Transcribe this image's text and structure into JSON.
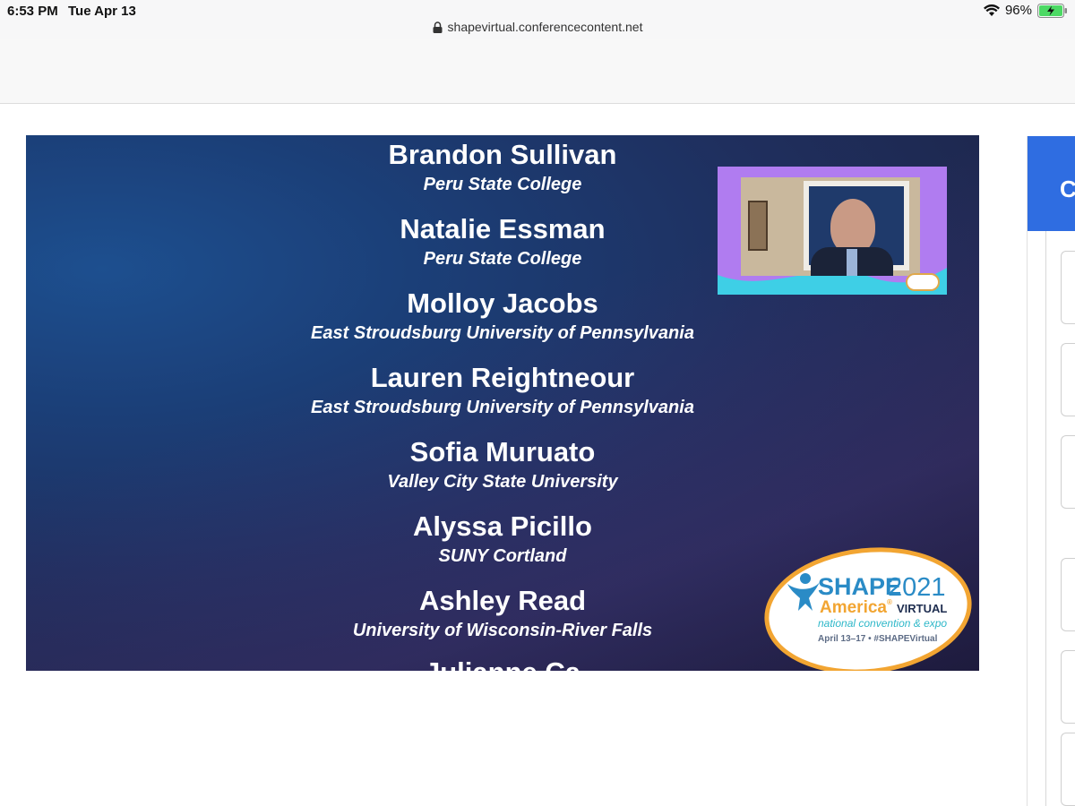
{
  "status_bar": {
    "time": "6:53 PM",
    "date": "Tue Apr 13",
    "battery": "96%"
  },
  "browser": {
    "url": "shapevirtual.conferencecontent.net"
  },
  "video": {
    "credits": [
      {
        "name": "Brandon Sullivan",
        "school": "Peru State College"
      },
      {
        "name": "Natalie Essman",
        "school": "Peru State College"
      },
      {
        "name": "Molloy Jacobs",
        "school": "East Stroudsburg University of Pennsylvania"
      },
      {
        "name": "Lauren Reightneour",
        "school": "East Stroudsburg University of Pennsylvania"
      },
      {
        "name": "Sofia Muruato",
        "school": "Valley City State University"
      },
      {
        "name": "Alyssa Picillo",
        "school": "SUNY Cortland"
      },
      {
        "name": "Ashley Read",
        "school": "University of Wisconsin-River Falls"
      }
    ],
    "partial_next": "Julianne Ca",
    "logo": {
      "shape": "SHAPE",
      "year": "2021",
      "america": "America",
      "reg": "®",
      "virtual": "VIRTUAL",
      "subtitle": "national convention & expo",
      "dates": "April 13–17 • #SHAPEVirtual"
    }
  },
  "side_panel": {
    "header_label": "C"
  },
  "colors": {
    "side_header": "#2f6de1",
    "logo_blue": "#2a8bc6",
    "logo_orange": "#f2a532"
  }
}
